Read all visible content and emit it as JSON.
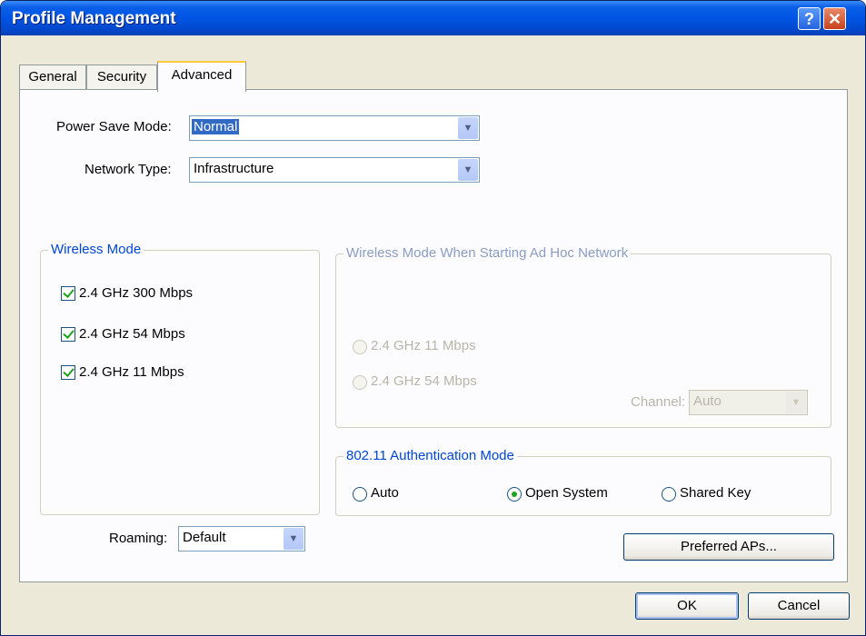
{
  "window": {
    "title": "Profile Management",
    "help_label": "?",
    "close_label": "✕"
  },
  "tabs": [
    {
      "label": "General"
    },
    {
      "label": "Security"
    },
    {
      "label": "Advanced"
    }
  ],
  "active_tab": "Advanced",
  "power_save": {
    "label": "Power Save Mode:",
    "value": "Normal"
  },
  "network_type": {
    "label": "Network Type:",
    "value": "Infrastructure"
  },
  "wireless_mode": {
    "legend": "Wireless Mode",
    "options": [
      {
        "label": "2.4 GHz 300 Mbps",
        "checked": true
      },
      {
        "label": "2.4 GHz 54 Mbps",
        "checked": true
      },
      {
        "label": "2.4 GHz 11 Mbps",
        "checked": true
      }
    ]
  },
  "adhoc": {
    "legend": "Wireless Mode When Starting Ad Hoc Network",
    "options": [
      {
        "label": "2.4 GHz 11 Mbps"
      },
      {
        "label": "2.4 GHz 54 Mbps"
      }
    ],
    "channel_label": "Channel:",
    "channel_value": "Auto"
  },
  "auth": {
    "legend": "802.11 Authentication Mode",
    "options": [
      {
        "label": "Auto",
        "selected": false
      },
      {
        "label": "Open System",
        "selected": true
      },
      {
        "label": "Shared Key",
        "selected": false
      }
    ]
  },
  "roaming": {
    "label": "Roaming:",
    "value": "Default"
  },
  "buttons": {
    "preferred_aps": "Preferred APs...",
    "ok": "OK",
    "cancel": "Cancel"
  },
  "icons": {
    "dropdown": "▼"
  },
  "colors": {
    "titlebar": "#0054e3",
    "group_legend": "#0046d5",
    "check": "#21a121",
    "selection": "#316ac5"
  }
}
